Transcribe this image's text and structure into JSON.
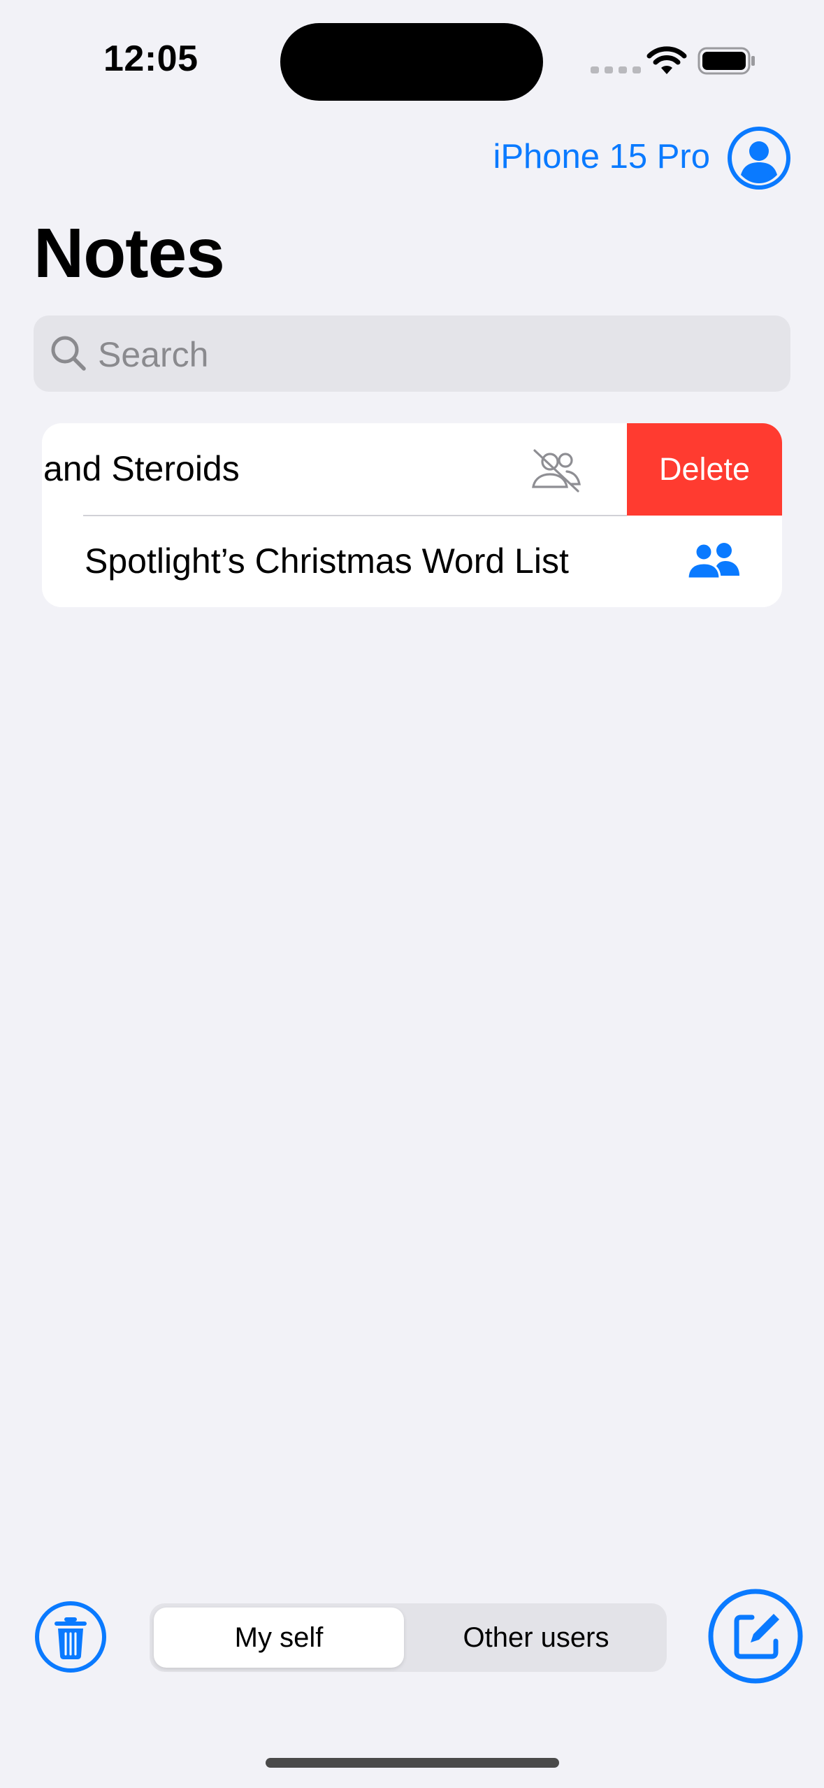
{
  "status_bar": {
    "time": "12:05",
    "icons": [
      "signal-dots-icon",
      "wifi-icon",
      "battery-icon"
    ]
  },
  "nav": {
    "device_name": "iPhone 15 Pro",
    "profile_icon": "person-circle-icon"
  },
  "title": "Notes",
  "search": {
    "placeholder": "Search",
    "value": ""
  },
  "notes": [
    {
      "title": "and Steroids",
      "icon": "person-2-slash-icon",
      "swipe_action": "Delete"
    },
    {
      "title": "Spotlight’s Christmas Word List",
      "icon": "person-2-fill-icon"
    }
  ],
  "bottom_bar": {
    "trash_icon": "trash-icon",
    "segments": [
      "My self",
      "Other users"
    ],
    "selected_segment": "My self",
    "compose_icon": "square-and-pencil-icon"
  },
  "colors": {
    "accent": "#0A7AFF",
    "delete": "#FF3B30",
    "background": "#F2F2F7"
  }
}
